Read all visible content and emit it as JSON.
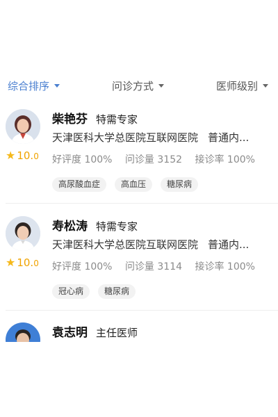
{
  "filters": [
    {
      "label": "综合排序",
      "active": true
    },
    {
      "label": "问诊方式",
      "active": false
    },
    {
      "label": "医师级别",
      "active": false
    }
  ],
  "doctors": [
    {
      "name": "柴艳芬",
      "title": "特需专家",
      "hospital": "天津医科大学总医院互联网医院",
      "department": "普通内...",
      "rating_icon": "star-icon",
      "rating": "10.",
      "rating_tail": "0",
      "praise": "好评度 100%",
      "consultations": "问诊量 3152",
      "acceptance": "接诊率 100%",
      "tags": [
        "高尿酸血症",
        "高血压",
        "糖尿病"
      ]
    },
    {
      "name": "寿松涛",
      "title": "特需专家",
      "hospital": "天津医科大学总医院互联网医院",
      "department": "普通内...",
      "rating_icon": "star-icon",
      "rating": "10.",
      "rating_tail": "0",
      "praise": "好评度 100%",
      "consultations": "问诊量 3114",
      "acceptance": "接诊率 100%",
      "tags": [
        "冠心病",
        "糖尿病"
      ]
    },
    {
      "name": "袁志明",
      "title": "主任医师"
    }
  ],
  "colors": {
    "accent": "#4a7fd0",
    "star": "#f5b81a",
    "score": "#f0a300",
    "muted_text": "#8a8a8a",
    "tag_bg": "#f2f2f2"
  }
}
